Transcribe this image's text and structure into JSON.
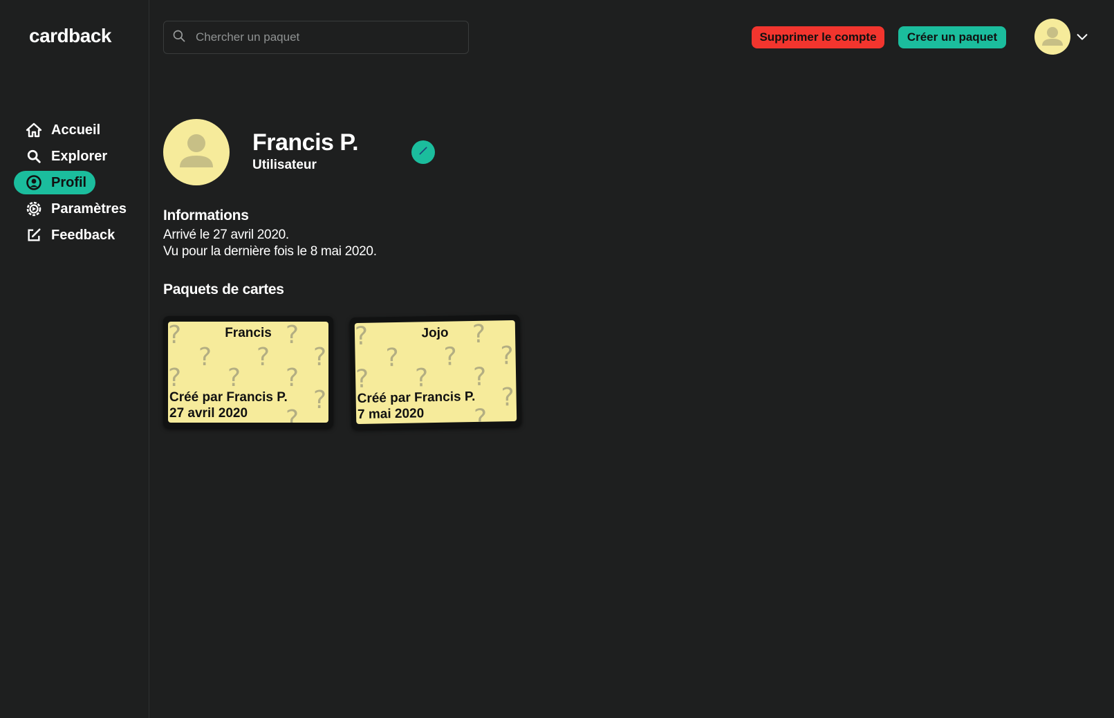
{
  "app": {
    "logo": "cardback"
  },
  "sidebar": {
    "items": [
      {
        "label": "Accueil",
        "icon": "home-icon",
        "active": false
      },
      {
        "label": "Explorer",
        "icon": "search-icon",
        "active": false
      },
      {
        "label": "Profil",
        "icon": "user-circle-icon",
        "active": true
      },
      {
        "label": "Paramètres",
        "icon": "gear-icon",
        "active": false
      },
      {
        "label": "Feedback",
        "icon": "edit-icon",
        "active": false
      }
    ]
  },
  "header": {
    "search_placeholder": "Chercher un paquet",
    "delete_account_label": "Supprimer le compte",
    "create_deck_label": "Créer un paquet"
  },
  "profile": {
    "name": "Francis P.",
    "role": "Utilisateur"
  },
  "informations": {
    "title": "Informations",
    "joined": "Arrivé le 27 avril 2020.",
    "last_seen": "Vu pour la dernière fois le 8 mai 2020."
  },
  "decks": {
    "title": "Paquets de cartes",
    "items": [
      {
        "title": "Francis",
        "author": "Créé par Francis P.",
        "date": "27 avril 2020"
      },
      {
        "title": "Jojo",
        "author": "Créé par Francis P.",
        "date": "7 mai 2020"
      }
    ]
  },
  "colors": {
    "background": "#1e1f1f",
    "accent": "#1bbd9d",
    "danger": "#f2352e",
    "avatar": "#f6eb9b"
  }
}
